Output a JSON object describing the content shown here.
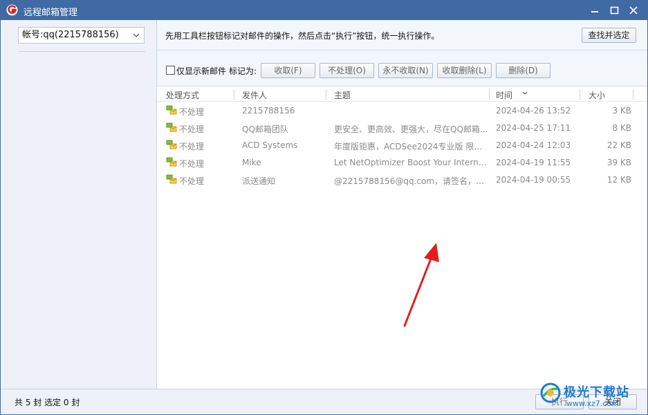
{
  "window": {
    "title": "远程邮箱管理"
  },
  "sidebar": {
    "account_label": "帐号:qq(2215788156)"
  },
  "hint": {
    "text": "先用工具栏按钮标记对邮件的操作，然后点击“执行”按钮，统一执行操作。",
    "find_button": "查找并选定"
  },
  "toolbar": {
    "show_new_only": "仅显示新邮件",
    "mark_as": "标记为:",
    "buttons": [
      "收取(F)",
      "不处理(O)",
      "永不收取(N)",
      "收取删除(L)",
      "删除(D)"
    ]
  },
  "table": {
    "columns": [
      "处理方式",
      "发件人",
      "主题",
      "时间",
      "大小"
    ],
    "rows": [
      {
        "status": "不处理",
        "from": "2215788156",
        "subject": "",
        "time": "2024-04-26 13:52",
        "size": "3 KB"
      },
      {
        "status": "不处理",
        "from": "QQ邮箱团队",
        "subject": "更安全、更高效、更强大，尽在QQ邮箱...",
        "time": "2024-04-25 17:11",
        "size": "8 KB"
      },
      {
        "status": "不处理",
        "from": "ACD Systems",
        "subject": "年度版钜惠，ACDSee2024专业版 限时...",
        "time": "2024-04-24 12:03",
        "size": "22 KB"
      },
      {
        "status": "不处理",
        "from": "Mike",
        "subject": "Let NetOptimizer Boost Your Interne...",
        "time": "2024-04-19 11:55",
        "size": "39 KB"
      },
      {
        "status": "不处理",
        "from": "派送通知",
        "subject": "@2215788156@qq.com，请签名，你...",
        "time": "2024-04-19 00:55",
        "size": "12 KB"
      }
    ]
  },
  "statusbar": {
    "text": "共 5 封 选定 0 封",
    "exec_button": "执行",
    "close_button": "关闭"
  },
  "watermark": {
    "title": "极光下载站",
    "url": "www.xz7.com"
  },
  "colors": {
    "titlebar": "#3f6aa3",
    "arrow": "#e02020",
    "watermark": "#1e7ad1"
  }
}
